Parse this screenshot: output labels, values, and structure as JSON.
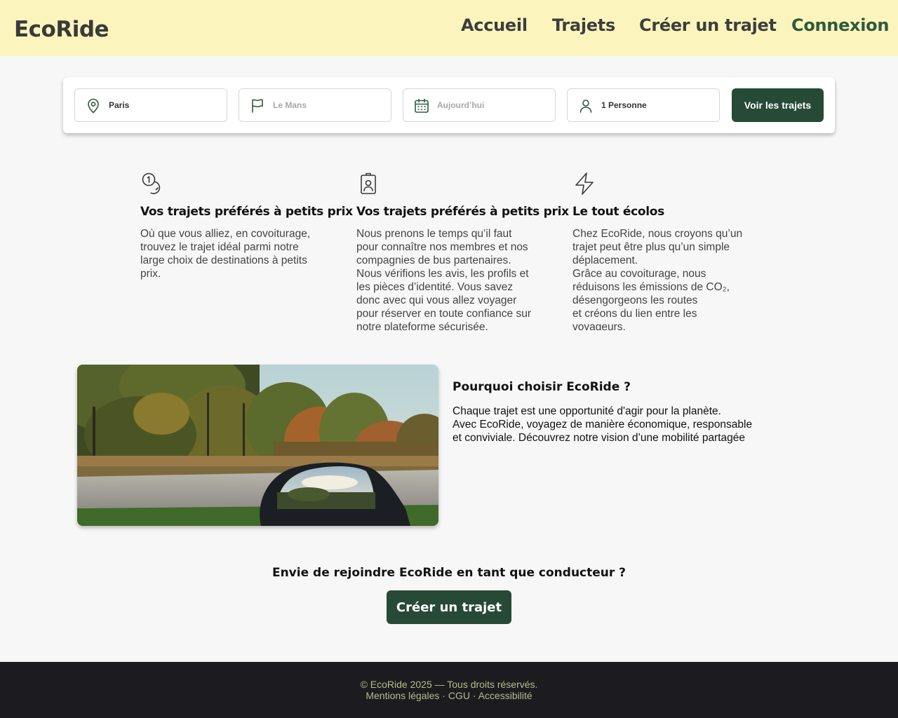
{
  "header": {
    "logo": "EcoRide",
    "nav": [
      "Accueil",
      "Trajets",
      "Créer un trajet",
      "Connexion"
    ]
  },
  "search": {
    "departure": "Paris",
    "destination_placeholder": "Le Mans",
    "date_placeholder": "Aujourd’hui",
    "passengers": "1 Personne",
    "submit_label": "Voir les trajets"
  },
  "features": [
    {
      "icon": "coins-icon",
      "title": "Vos trajets préférés à petits prix",
      "text": "Où que vous alliez, en covoiturage,\ntrouvez le trajet idéal parmi notre\nlarge choix de destinations à petits\nprix."
    },
    {
      "icon": "id-badge-icon",
      "title": "Vos trajets préférés à petits prix",
      "text": "Nous prenons le temps qu’il faut\npour connaître nos membres et nos\ncompagnies de bus partenaires.\nNous vérifions les avis, les profils et\nles pièces d’identité. Vous savez\ndonc avec qui vous allez voyager\npour réserver en toute confiance sur\nnotre plateforme sécurisée."
    },
    {
      "icon": "lightning-icon",
      "title": "Le tout écolos",
      "text": "Chez EcoRide, nous croyons qu’un\ntrajet peut être plus qu’un simple\ndéplacement.\n Grâce au covoiturage, nous\nréduisons les émissions de CO₂,\ndésengorgeons les routes\n et créons du lien entre les\nvoyageurs."
    }
  ],
  "why": {
    "title": "Pourquoi choisir EcoRide ?",
    "text": "Chaque trajet est une opportunité d'agir pour la planète.\n Avec EcoRide, voyagez de manière économique, responsable\n et conviviale. Découvrez notre vision d’une mobilité partagée"
  },
  "cta": {
    "title": "Envie de rejoindre EcoRide en tant que conducteur ?",
    "button": "Créer un trajet"
  },
  "footer": {
    "copyright": "© EcoRide 2025 — Tous droits réservés.",
    "links": [
      "Mentions légales",
      "CGU",
      "Accessibilité"
    ],
    "separator": " · "
  },
  "colors": {
    "header_bg": "#fbf5bd",
    "accent": "#264a36",
    "footer_bg": "#1c1c20",
    "footer_text": "#b7bd87"
  }
}
